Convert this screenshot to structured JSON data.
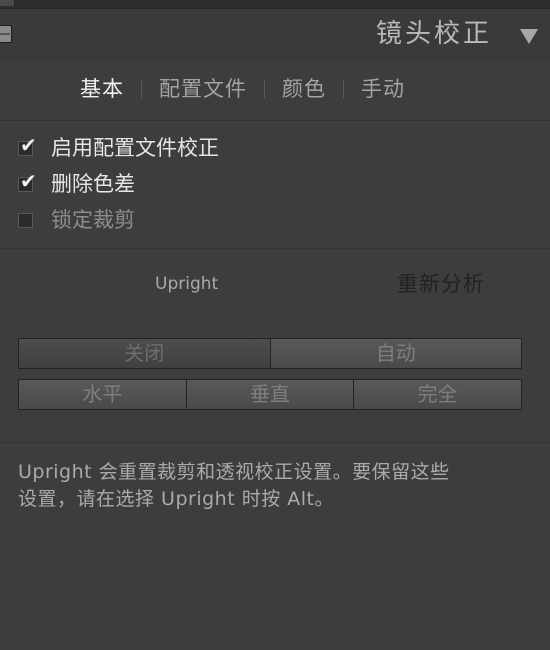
{
  "header": {
    "title": "镜头校正",
    "collapse_icon": "triangle-down-icon",
    "panel_switch_icon": "panel-switch-icon"
  },
  "tabs": [
    {
      "label": "基本",
      "active": true
    },
    {
      "label": "配置文件",
      "active": false
    },
    {
      "label": "颜色",
      "active": false
    },
    {
      "label": "手动",
      "active": false
    }
  ],
  "options": {
    "enable_profile": {
      "label": "启用配置文件校正",
      "checked": true
    },
    "remove_ca": {
      "label": "删除色差",
      "checked": true
    },
    "lock_crop": {
      "label": "锁定裁剪",
      "checked": false
    }
  },
  "upright": {
    "label": "Upright",
    "reanalyze": "重新分析",
    "buttons_row1": [
      "关闭",
      "自动"
    ],
    "buttons_row2": [
      "水平",
      "垂直",
      "完全"
    ],
    "selected": "关闭"
  },
  "info": {
    "line1": "Upright 会重置裁剪和透视校正设置。要保留这些",
    "line2": "设置，请在选择 Upright 时按 Alt。"
  },
  "colors": {
    "background": "#3d3d3d",
    "text_active": "#f0f0f0",
    "text_normal": "#a3a3a3"
  }
}
